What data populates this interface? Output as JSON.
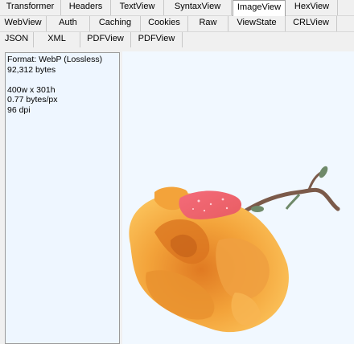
{
  "tabs": {
    "row1": [
      "Transformer",
      "Headers",
      "TextView",
      "SyntaxView",
      "ImageView",
      "HexView"
    ],
    "row2": [
      "WebView",
      "Auth",
      "Caching",
      "Cookies",
      "Raw",
      "ViewState",
      "CRLView"
    ],
    "row3": [
      "JSON",
      "XML",
      "PDFView",
      "PDFView"
    ],
    "selected": "ImageView"
  },
  "image_info": {
    "format": "Format: WebP (Lossless)",
    "size": "92,312 bytes",
    "dimensions": "400w x 301h",
    "density": "0.77 bytes/px",
    "dpi": "96 dpi"
  },
  "image": {
    "subject": "orange-rose",
    "colors": {
      "petal": "#f3a33a",
      "petal_dark": "#d9731f",
      "petal_light": "#fbc25a",
      "pink_tip": "#f06a78",
      "stem": "#7b5a4a",
      "leaf": "#6f8a6a"
    }
  }
}
